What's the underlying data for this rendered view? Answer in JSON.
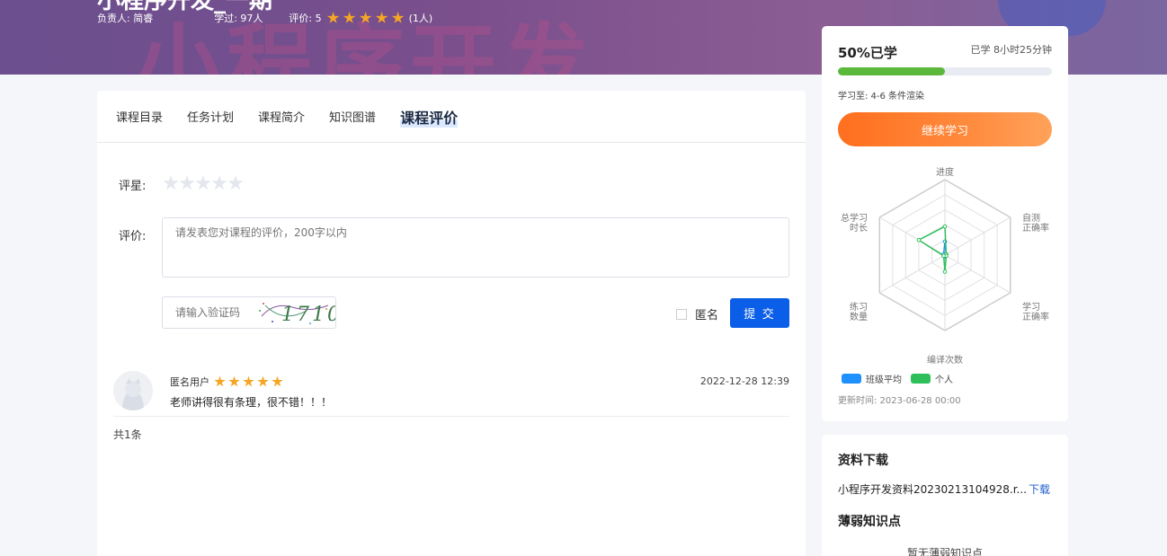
{
  "course": {
    "title_partial": "小程序开发_一期",
    "owner": "负责人: 简睿",
    "learners": "学过: 97人",
    "rating_label": "评价: 5",
    "rating_stars": 5,
    "rating_count": "(1人)"
  },
  "tabs": [
    "课程目录",
    "任务计划",
    "课程简介",
    "知识图谱",
    "课程评价"
  ],
  "review_form": {
    "score_label": "评星:",
    "comment_label": "评价:",
    "comment_placeholder": "请发表您对课程的评价，200字以内",
    "captcha_placeholder": "请输入验证码",
    "captcha_text": "1710",
    "anonymous_label": "匿名",
    "submit_label": "提 交"
  },
  "comments": [
    {
      "user": "匿名用户",
      "stars": 5,
      "time": "2022-12-28 12:39",
      "text": "老师讲得很有条理，很不错！！！"
    }
  ],
  "total": "共1条",
  "progress": {
    "percent_label": "50%已学",
    "percent": 50,
    "studied_time": "已学 8小时25分钟",
    "study_to": "学习至: 4-6 条件渲染",
    "continue_label": "继续学习",
    "updated": "更新时间: 2023-06-28 00:00",
    "colors": {
      "fill": "#5cb83b",
      "class": "#1e90ff",
      "personal": "#2ebf5b"
    }
  },
  "radar": {
    "axes": [
      {
        "label1": "进度",
        "label2": ""
      },
      {
        "label1": "自测",
        "label2": "正确率"
      },
      {
        "label1": "学习",
        "label2": "正确率"
      },
      {
        "label1": "编译次数",
        "label2": ""
      },
      {
        "label1": "练习",
        "label2": "数量"
      },
      {
        "label1": "总学习",
        "label2": "时长"
      }
    ],
    "class_avg": [
      0.18,
      0.02,
      0.02,
      0.02,
      0.02,
      0.02
    ],
    "personal": [
      0.38,
      0.02,
      0.02,
      0.22,
      0.02,
      0.4
    ],
    "legend": [
      "班级平均",
      "个人"
    ]
  },
  "resources": {
    "title": "资料下载",
    "file_name": "小程序开发资料20230213104928.r...",
    "download_label": "下载",
    "weak_title": "薄弱知识点",
    "weak_none": "暂无薄弱知识点"
  }
}
